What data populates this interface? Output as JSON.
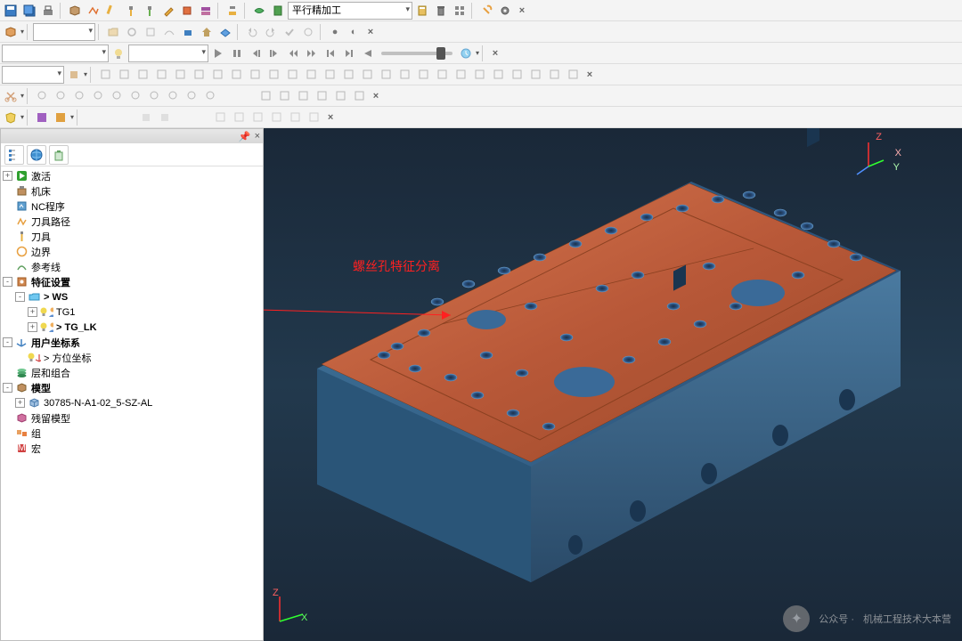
{
  "toolbars": {
    "dropdown_operation": "平行精加工",
    "dropdown_empty": ""
  },
  "tree": {
    "items": [
      {
        "label": "激活",
        "icon": "play",
        "exp": "+",
        "indent": 0,
        "bold": false
      },
      {
        "label": "机床",
        "icon": "machine",
        "exp": "",
        "indent": 0,
        "bold": false
      },
      {
        "label": "NC程序",
        "icon": "nc",
        "exp": "",
        "indent": 0,
        "bold": false
      },
      {
        "label": "刀具路径",
        "icon": "toolpath",
        "exp": "",
        "indent": 0,
        "bold": false
      },
      {
        "label": "刀具",
        "icon": "tool",
        "exp": "",
        "indent": 0,
        "bold": false
      },
      {
        "label": "边界",
        "icon": "boundary",
        "exp": "",
        "indent": 0,
        "bold": false
      },
      {
        "label": "参考线",
        "icon": "refline",
        "exp": "",
        "indent": 0,
        "bold": false
      },
      {
        "label": "特征设置",
        "icon": "feature",
        "exp": "-",
        "indent": 0,
        "bold": true
      },
      {
        "label": "> WS",
        "icon": "folder",
        "exp": "-",
        "indent": 1,
        "bold": true
      },
      {
        "label": "TG1",
        "icon": "bulb-user",
        "exp": "+",
        "indent": 2,
        "bold": false
      },
      {
        "label": "> TG_LK",
        "icon": "bulb-user",
        "exp": "+",
        "indent": 2,
        "bold": true
      },
      {
        "label": "用户坐标系",
        "icon": "ucs",
        "exp": "-",
        "indent": 0,
        "bold": true
      },
      {
        "label": "> 方位坐标",
        "icon": "bulb-axis",
        "exp": "",
        "indent": 1,
        "bold": false
      },
      {
        "label": "层和组合",
        "icon": "layers",
        "exp": "",
        "indent": 0,
        "bold": false
      },
      {
        "label": "模型",
        "icon": "model",
        "exp": "-",
        "indent": 0,
        "bold": true
      },
      {
        "label": "30785-N-A1-02_5-SZ-AL",
        "icon": "cube",
        "exp": "+",
        "indent": 1,
        "bold": false
      },
      {
        "label": "残留模型",
        "icon": "residual",
        "exp": "",
        "indent": 0,
        "bold": false
      },
      {
        "label": "组",
        "icon": "group",
        "exp": "",
        "indent": 0,
        "bold": false
      },
      {
        "label": "宏",
        "icon": "macro",
        "exp": "",
        "indent": 0,
        "bold": false
      }
    ]
  },
  "viewport": {
    "annotation": "螺丝孔特征分离",
    "axes": {
      "x": "X",
      "y": "Y",
      "z": "Z"
    }
  },
  "watermark": {
    "prefix": "公众号 ·",
    "text": "机械工程技术大本营"
  }
}
